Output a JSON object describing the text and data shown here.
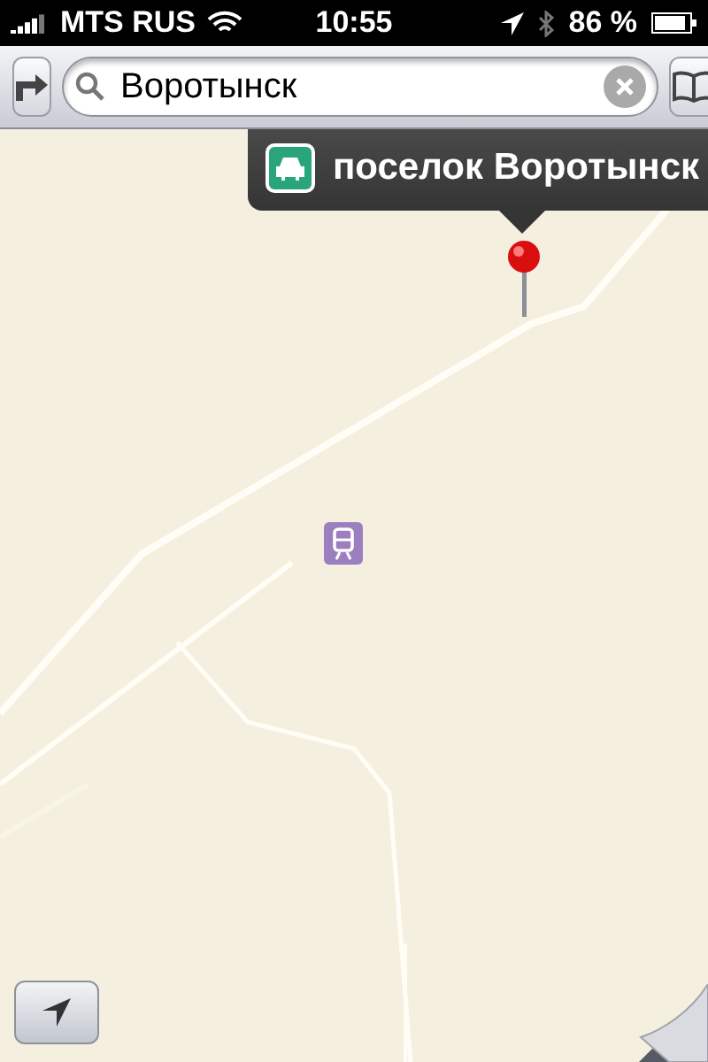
{
  "status_bar": {
    "carrier": "MTS RUS",
    "time": "10:55",
    "battery": "86 %"
  },
  "search": {
    "value": "Воротынск"
  },
  "callout": {
    "title": "поселок Воротынск"
  }
}
